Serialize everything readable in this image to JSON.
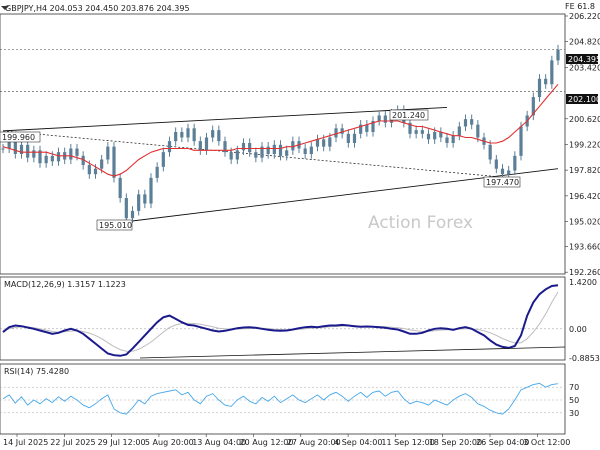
{
  "header": {
    "symbol_line": "GBPJPY,H4  204.053 204.450 203.876 204.395",
    "right_tag": "FE 61.8"
  },
  "watermark": "Action Forex",
  "colors": {
    "candle": "#5b7f96",
    "ma": "#e03030",
    "macd": "#1a1a8c",
    "signal": "#bdbdbd",
    "rsi": "#46a7ea",
    "trend": "#111111"
  },
  "annotations": {
    "price_current": "204.395",
    "level_202": "202.100",
    "left_high": "199.960",
    "low_label": "195.010",
    "mid_high": "201.240",
    "sep_low": "197.470"
  },
  "chart_data": {
    "type": "line",
    "title": "GBPJPY,H4",
    "x_tick_labels": [
      "14 Jul 2025",
      "22 Jul 2025",
      "29 Jul 12:00",
      "5 Aug 20:00",
      "13 Aug 04:00",
      "20 Aug 12:00",
      "27 Aug 20:00",
      "4 Sep 04:00",
      "11 Sep 12:00",
      "18 Sep 20:00",
      "26 Sep 04:00",
      "3 Oct 12:00"
    ],
    "price_panel": {
      "ylim": [
        192.27,
        206.22
      ],
      "y_ticks": [
        "206.220",
        "204.820",
        "203.420",
        "200.620",
        "199.220",
        "197.820",
        "196.420",
        "195.020",
        "193.660",
        "192.260"
      ],
      "close": [
        199.0,
        199.4,
        198.7,
        199.2,
        198.5,
        198.9,
        198.2,
        198.6,
        198.3,
        198.8,
        198.4,
        199.0,
        198.6,
        198.1,
        197.6,
        197.9,
        198.4,
        199.1,
        197.4,
        196.3,
        195.2,
        195.6,
        196.5,
        196.0,
        197.4,
        198.0,
        198.8,
        199.4,
        199.9,
        199.6,
        200.1,
        199.4,
        198.9,
        199.6,
        200.0,
        199.4,
        198.8,
        198.4,
        198.9,
        199.3,
        198.8,
        198.5,
        199.1,
        198.7,
        199.2,
        198.6,
        198.9,
        199.4,
        199.0,
        198.7,
        199.1,
        199.5,
        199.1,
        199.6,
        200.1,
        199.8,
        199.3,
        199.8,
        200.3,
        199.9,
        200.5,
        200.8,
        200.4,
        200.9,
        201.1,
        200.4,
        199.8,
        200.0,
        199.8,
        199.5,
        199.9,
        199.6,
        199.3,
        199.7,
        200.2,
        200.6,
        200.3,
        199.6,
        199.2,
        198.4,
        197.9,
        197.6,
        197.8,
        198.6,
        200.2,
        200.8,
        201.8,
        202.8,
        202.5,
        203.8,
        204.395
      ],
      "ma_period_label": "",
      "ma": [
        199.1,
        199.0,
        198.9,
        198.8,
        198.8,
        198.8,
        198.8,
        198.8,
        198.7,
        198.6,
        198.6,
        198.6,
        198.5,
        198.4,
        198.2,
        198.0,
        197.8,
        197.6,
        197.5,
        197.6,
        197.8,
        198.1,
        198.4,
        198.6,
        198.8,
        198.9,
        199.0,
        199.0,
        199.0,
        199.0,
        199.0,
        198.9,
        198.9,
        198.9,
        198.9,
        198.9,
        198.9,
        198.9,
        199.0,
        199.0,
        199.0,
        199.0,
        199.0,
        199.0,
        199.0,
        199.0,
        199.1,
        199.1,
        199.2,
        199.3,
        199.4,
        199.5,
        199.6,
        199.7,
        199.8,
        199.9,
        200.0,
        200.1,
        200.2,
        200.3,
        200.4,
        200.5,
        200.5,
        200.5,
        200.5,
        200.4,
        200.3,
        200.2,
        200.2,
        200.1,
        200.0,
        199.9,
        199.8,
        199.7,
        199.7,
        199.6,
        199.6,
        199.5,
        199.4,
        199.3,
        199.3,
        199.4,
        199.6,
        199.9,
        200.2,
        200.5,
        200.9,
        201.3,
        201.7,
        202.1,
        202.5
      ],
      "levels": {
        "dashed_1": 204.395,
        "dashed_2": 202.1
      }
    },
    "macd_panel": {
      "label": "MACD(12,26,9) 1.3157 1.1223",
      "ylim": [
        -0.8853,
        1.42
      ],
      "y_ticks": [
        "1.4200",
        "0.00",
        "-0.8853"
      ],
      "macd": [
        -0.1,
        0.05,
        0.1,
        0.08,
        0.04,
        0.0,
        -0.05,
        -0.1,
        -0.15,
        -0.12,
        -0.05,
        0.0,
        -0.05,
        -0.15,
        -0.3,
        -0.45,
        -0.6,
        -0.75,
        -0.8,
        -0.82,
        -0.78,
        -0.6,
        -0.4,
        -0.2,
        0.0,
        0.2,
        0.35,
        0.4,
        0.3,
        0.2,
        0.12,
        0.1,
        0.05,
        0.0,
        -0.05,
        -0.08,
        -0.06,
        -0.02,
        0.02,
        0.04,
        0.05,
        0.03,
        0.0,
        -0.03,
        -0.05,
        -0.06,
        -0.05,
        -0.02,
        0.02,
        0.05,
        0.06,
        0.05,
        0.08,
        0.1,
        0.1,
        0.12,
        0.1,
        0.08,
        0.06,
        0.07,
        0.06,
        0.05,
        0.03,
        0.0,
        -0.02,
        -0.08,
        -0.15,
        -0.15,
        -0.12,
        -0.05,
        0.0,
        0.02,
        0.0,
        -0.03,
        0.02,
        0.05,
        0.0,
        -0.1,
        -0.2,
        -0.35,
        -0.48,
        -0.55,
        -0.58,
        -0.52,
        -0.2,
        0.4,
        0.8,
        1.05,
        1.2,
        1.3,
        1.32
      ],
      "signal": [
        -0.05,
        0.0,
        0.04,
        0.06,
        0.05,
        0.03,
        0.0,
        -0.04,
        -0.08,
        -0.1,
        -0.09,
        -0.07,
        -0.06,
        -0.08,
        -0.13,
        -0.2,
        -0.3,
        -0.42,
        -0.54,
        -0.63,
        -0.68,
        -0.68,
        -0.62,
        -0.52,
        -0.4,
        -0.25,
        -0.1,
        0.04,
        0.12,
        0.16,
        0.17,
        0.16,
        0.14,
        0.1,
        0.06,
        0.02,
        0.0,
        -0.01,
        -0.01,
        0.0,
        0.01,
        0.02,
        0.02,
        0.01,
        -0.01,
        -0.02,
        -0.03,
        -0.03,
        -0.02,
        0.0,
        0.02,
        0.03,
        0.04,
        0.06,
        0.07,
        0.08,
        0.09,
        0.09,
        0.08,
        0.08,
        0.07,
        0.07,
        0.06,
        0.05,
        0.03,
        0.01,
        -0.03,
        -0.06,
        -0.08,
        -0.08,
        -0.06,
        -0.04,
        -0.03,
        -0.02,
        -0.01,
        0.0,
        0.0,
        -0.02,
        -0.06,
        -0.12,
        -0.2,
        -0.29,
        -0.37,
        -0.43,
        -0.42,
        -0.3,
        -0.1,
        0.15,
        0.45,
        0.8,
        1.12
      ]
    },
    "rsi_panel": {
      "label": "RSI(14) 75.4280",
      "ylim": [
        0,
        100
      ],
      "y_ticks": [
        "70",
        "50",
        "30"
      ],
      "rsi": [
        52,
        58,
        45,
        55,
        42,
        50,
        44,
        52,
        46,
        55,
        48,
        56,
        50,
        42,
        38,
        44,
        52,
        58,
        36,
        30,
        28,
        38,
        50,
        44,
        56,
        60,
        62,
        64,
        66,
        58,
        62,
        50,
        44,
        56,
        60,
        50,
        42,
        40,
        50,
        56,
        48,
        44,
        54,
        48,
        56,
        46,
        52,
        58,
        50,
        46,
        52,
        58,
        50,
        58,
        62,
        56,
        48,
        56,
        62,
        54,
        62,
        64,
        56,
        62,
        64,
        52,
        44,
        48,
        46,
        42,
        50,
        46,
        42,
        50,
        56,
        60,
        54,
        44,
        40,
        34,
        30,
        28,
        36,
        50,
        66,
        70,
        74,
        76,
        70,
        74,
        75.428
      ]
    }
  }
}
